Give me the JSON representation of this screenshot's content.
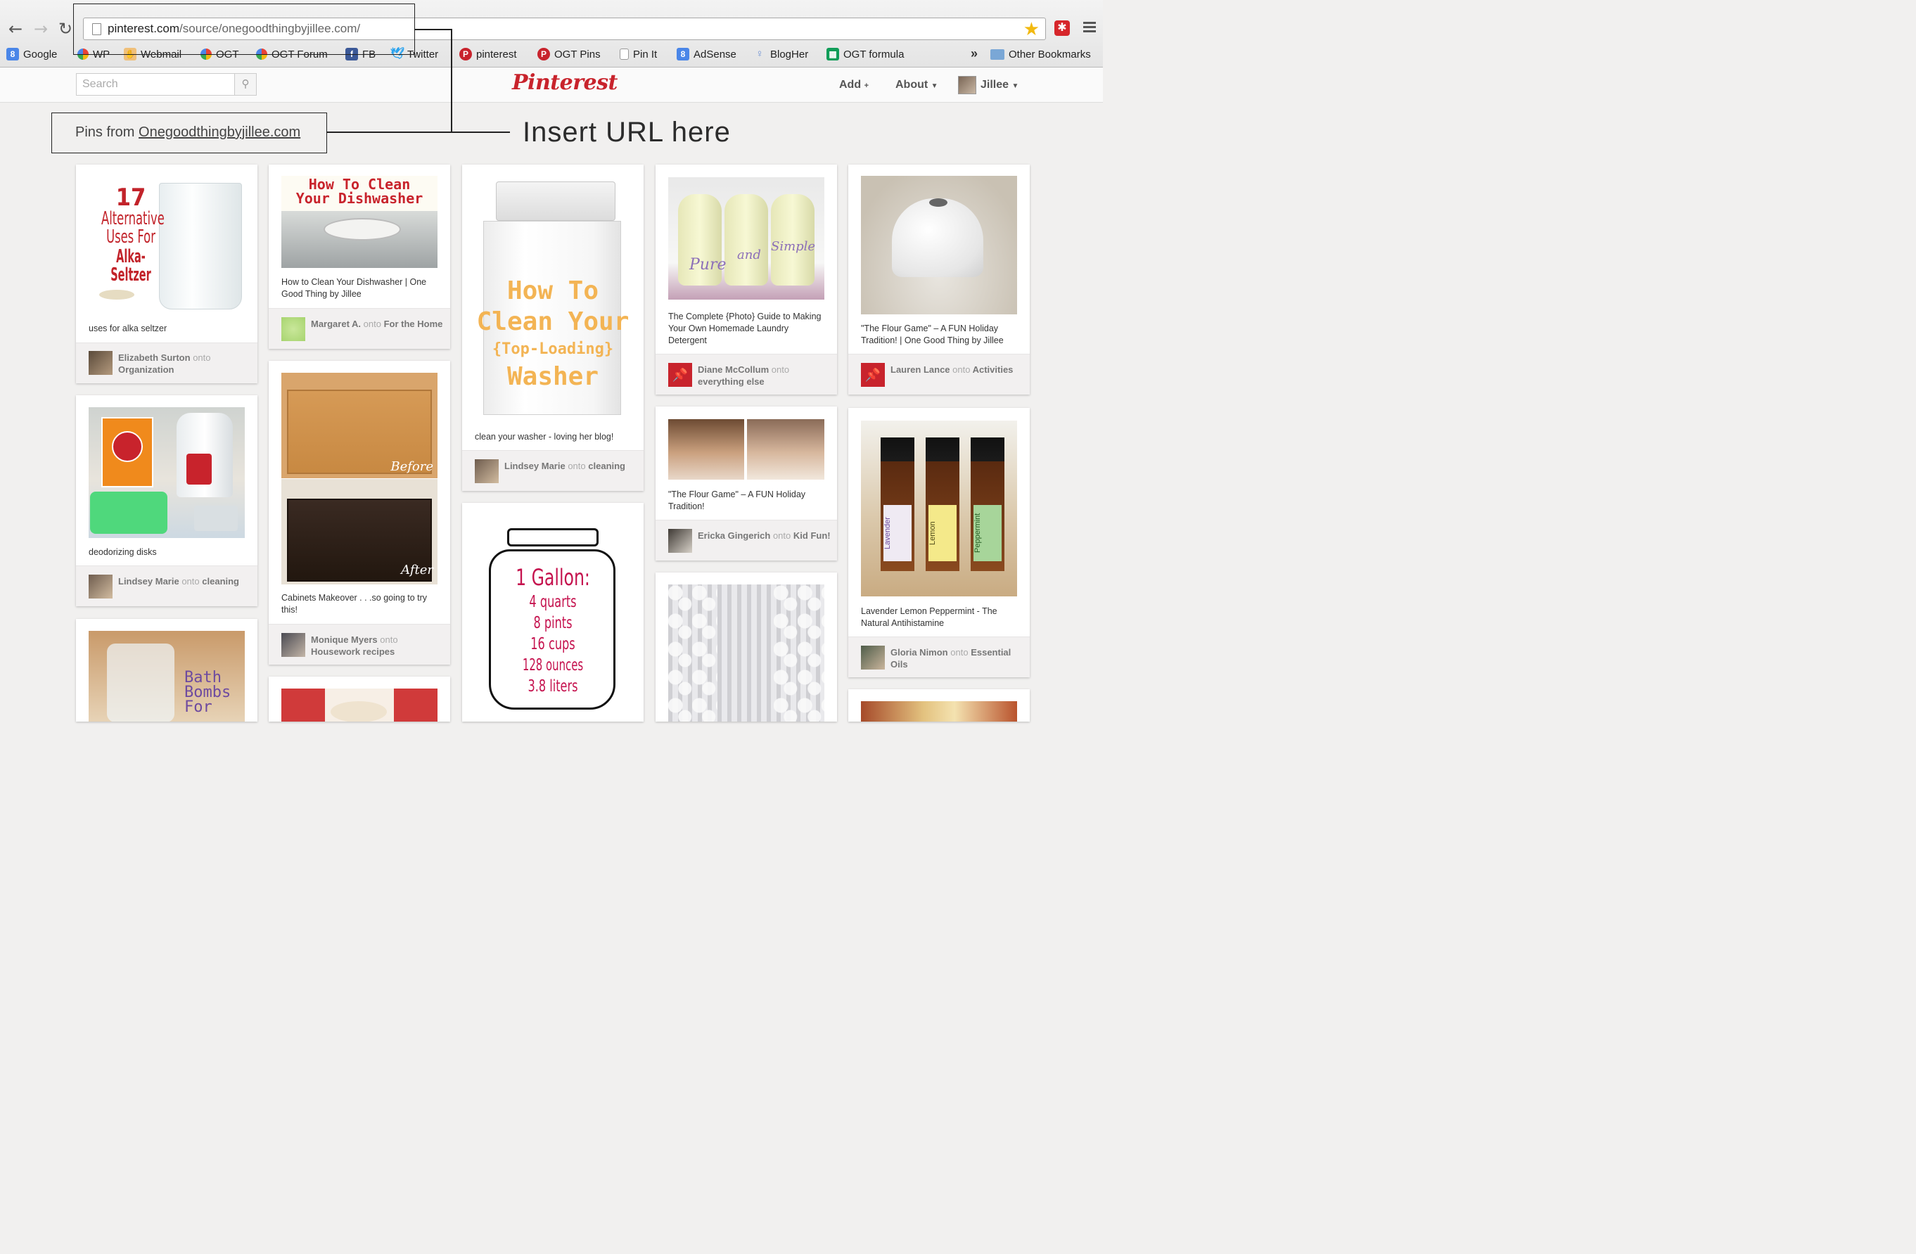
{
  "browser": {
    "url_host": "pinterest.com",
    "url_path": "/source/onegoodthingbyjillee.com/",
    "bookmarks": [
      {
        "label": "Google",
        "icon": "google-icon",
        "color": "#4a86e8"
      },
      {
        "label": "WP",
        "icon": "multicolor-icon",
        "color": "#e94235"
      },
      {
        "label": "Webmail",
        "icon": "hand-icon",
        "color": "#e9a23b"
      },
      {
        "label": "OGT",
        "icon": "multicolor-icon",
        "color": "#e94235"
      },
      {
        "label": "OGT Forum",
        "icon": "multicolor-icon",
        "color": "#e94235"
      },
      {
        "label": "FB",
        "icon": "facebook-icon",
        "color": "#3b5998"
      },
      {
        "label": "Twitter",
        "icon": "twitter-icon",
        "color": "#2aa3ef"
      },
      {
        "label": "pinterest",
        "icon": "pinterest-icon",
        "color": "#c8232c"
      },
      {
        "label": "OGT Pins",
        "icon": "pinterest-icon",
        "color": "#c8232c"
      },
      {
        "label": "Pin It",
        "icon": "page-icon",
        "color": "#999999"
      },
      {
        "label": "AdSense",
        "icon": "google-icon",
        "color": "#4a86e8"
      },
      {
        "label": "BlogHer",
        "icon": "blogher-icon",
        "color": "#6b8fd3"
      },
      {
        "label": "OGT formula",
        "icon": "sheets-icon",
        "color": "#0f9d58"
      }
    ],
    "more_bookmarks": "»",
    "other_bookmarks": "Other Bookmarks"
  },
  "header": {
    "search_placeholder": "Search",
    "logo": "Pinterest",
    "add_label": "Add",
    "about_label": "About",
    "user_name": "Jillee"
  },
  "page": {
    "pins_from_prefix": "Pins from ",
    "pins_from_link": "Onegoodthingbyjillee.com",
    "annotation": "Insert URL here"
  },
  "pins": [
    {
      "title_lines": [
        "17",
        "Alternative",
        "Uses For",
        "Alka-Seltzer"
      ],
      "desc": "uses for alka seltzer",
      "user": "Elizabeth Surton",
      "onto": "onto",
      "board": "Organization"
    },
    {
      "title_lines": [
        "How To Clean",
        "Your Dishwasher"
      ],
      "desc": "How to Clean Your Dishwasher | One Good Thing by Jillee",
      "user": "Margaret A.",
      "onto": "onto",
      "board": "For the Home"
    },
    {
      "title_lines": [
        "How To",
        "Clean Your",
        "{Top-Loading}",
        "Washer"
      ],
      "desc": "clean your washer - loving her blog!",
      "user": "Lindsey Marie",
      "onto": "onto",
      "board": "cleaning"
    },
    {
      "title_lines": [
        "Pure",
        "and",
        "Simple"
      ],
      "desc": "The Complete {Photo} Guide to Making Your Own Homemade Laundry Detergent",
      "user": "Diane McCollum",
      "onto": "onto",
      "board": "everything else"
    },
    {
      "desc": "\"The Flour Game\" – A FUN Holiday Tradition! | One Good Thing by Jillee",
      "user": "Lauren Lance",
      "onto": "onto",
      "board": "Activities"
    },
    {
      "desc": "deodorizing disks",
      "user": "Lindsey Marie",
      "onto": "onto",
      "board": "cleaning"
    },
    {
      "overlay_top": "Before",
      "overlay_bottom": "After",
      "desc": "Cabinets Makeover . . .so going to try this!",
      "user": "Monique Myers",
      "onto": "onto",
      "board": "Housework recipes"
    },
    {
      "title_lines": [
        "1 Gallon:",
        "4 quarts",
        "8 pints",
        "16 cups",
        "128 ounces",
        "3.8 liters"
      ]
    },
    {
      "desc": "\"The Flour Game\" – A FUN Holiday Tradition!",
      "user": "Ericka Gingerich",
      "onto": "onto",
      "board": "Kid Fun!"
    },
    {
      "bottle_labels": [
        "Lavender",
        "Lemon",
        "Peppermint"
      ],
      "desc": "Lavender Lemon Peppermint - The Natural Antihistamine",
      "user": "Gloria Nimon",
      "onto": "onto",
      "board": "Essential Oils"
    },
    {
      "title_lines": [
        "Bath",
        "Bombs",
        "For"
      ]
    }
  ]
}
